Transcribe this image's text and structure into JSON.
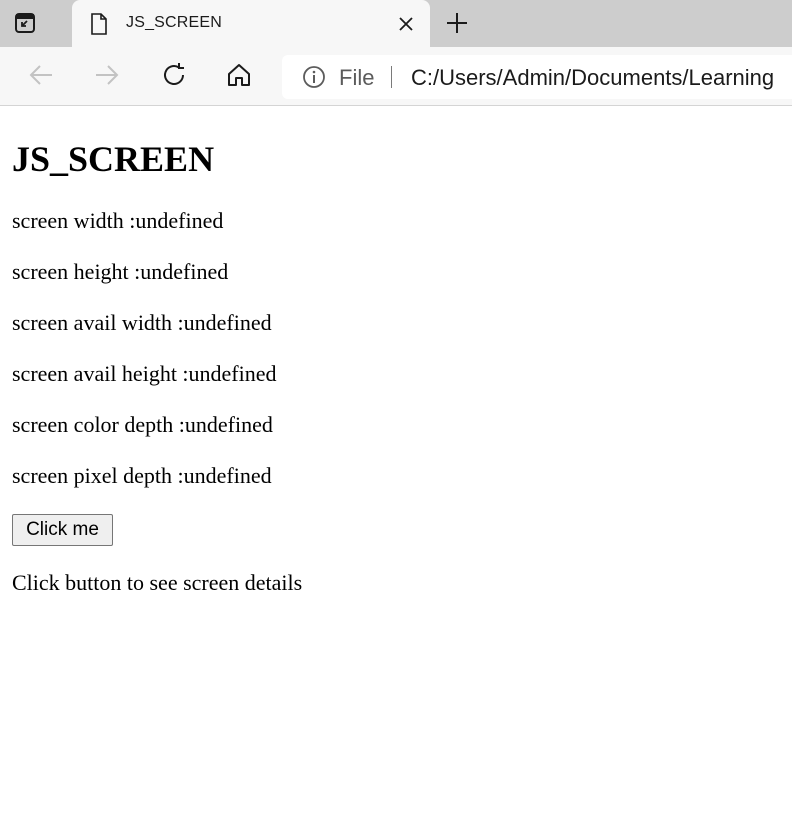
{
  "browser": {
    "tab": {
      "title": "JS_SCREEN"
    },
    "address_bar": {
      "scheme_label": "File",
      "url": "C:/Users/Admin/Documents/Learning"
    },
    "icons": {
      "tab_actions": "tab-actions-icon",
      "page": "page-icon",
      "close": "close-icon",
      "new_tab": "plus-icon",
      "back": "back-arrow-icon",
      "forward": "forward-arrow-icon",
      "refresh": "refresh-icon",
      "home": "home-icon",
      "info": "info-icon"
    }
  },
  "page": {
    "heading": "JS_SCREEN",
    "lines": {
      "width": "screen width :undefined",
      "height": "screen height :undefined",
      "avail_width": "screen avail width :undefined",
      "avail_height": "screen avail height :undefined",
      "color_depth": "screen color depth :undefined",
      "pixel_depth": "screen pixel depth :undefined"
    },
    "button_label": "Click me",
    "hint": "Click button to see screen details"
  }
}
